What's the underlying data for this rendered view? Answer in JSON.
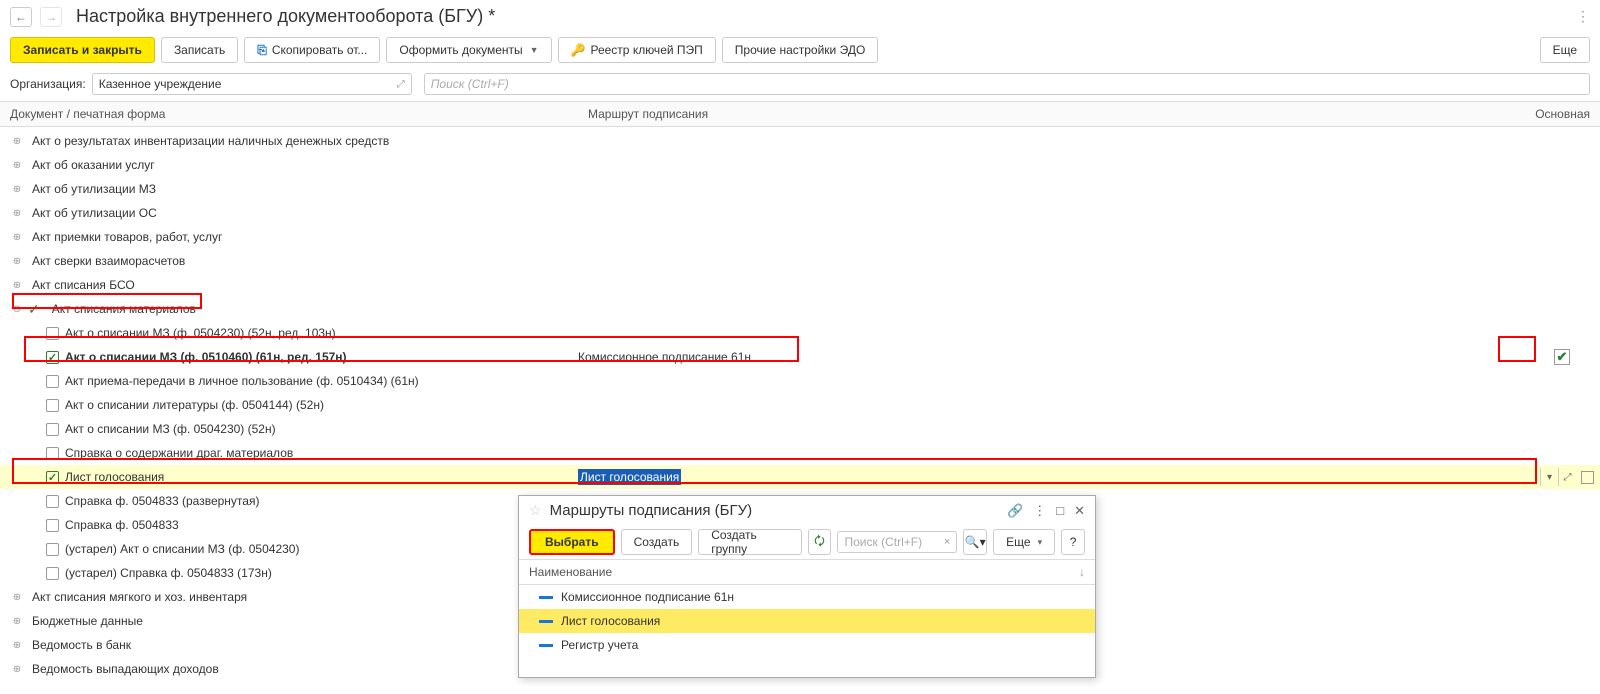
{
  "title": "Настройка внутреннего документооборота (БГУ) *",
  "toolbar": {
    "save_close": "Записать и закрыть",
    "save": "Записать",
    "copy": "Скопировать от...",
    "docs": "Оформить документы",
    "keys": "Реестр ключей ПЭП",
    "other": "Прочие настройки ЭДО",
    "more": "Еще"
  },
  "org": {
    "label": "Организация:",
    "value": "Казенное учреждение"
  },
  "search_ph": "Поиск (Ctrl+F)",
  "cols": {
    "c1": "Документ / печатная форма",
    "c2": "Маршрут подписания",
    "c3": "Основная"
  },
  "tree": {
    "g0": "Акт о результатах инвентаризации наличных денежных средств",
    "g1": "Акт об оказании услуг",
    "g2": "Акт об утилизации МЗ",
    "g3": "Акт об утилизации ОС",
    "g4": "Акт приемки товаров, работ, услуг",
    "g5": "Акт сверки взаиморасчетов",
    "g6": "Акт списания БСО",
    "g7": "Акт списания материалов",
    "i0": "Акт о списании МЗ (ф. 0504230) (52н, ред. 103н)",
    "i1": "Акт о списании МЗ (ф. 0510460) (61н, ред. 157н)",
    "i1r": "Комиссионное подписание 61н",
    "i2": "Акт приема-передачи в личное пользование (ф. 0510434) (61н)",
    "i3": "Акт о списании литературы (ф. 0504144) (52н)",
    "i4": "Акт о списании МЗ (ф. 0504230) (52н)",
    "i5": "Справка о содержании драг. материалов",
    "i6": "Лист голосования",
    "i6r": "Лист голосования",
    "i7": "Справка ф. 0504833 (развернутая)",
    "i8": "Справка ф. 0504833",
    "i9": "(устарел) Акт о списании МЗ (ф. 0504230)",
    "i10": "(устарел) Справка ф. 0504833 (173н)",
    "g8": "Акт списания мягкого и хоз. инвентаря",
    "g9": "Бюджетные данные",
    "g10": "Ведомость в банк",
    "g11": "Ведомость выпадающих доходов"
  },
  "popup": {
    "title": "Маршруты подписания (БГУ)",
    "select": "Выбрать",
    "create": "Создать",
    "create_grp": "Создать группу",
    "search_ph": "Поиск (Ctrl+F)",
    "more": "Еще",
    "col": "Наименование",
    "r0": "Комиссионное подписание 61н",
    "r1": "Лист голосования",
    "r2": "Регистр учета"
  }
}
